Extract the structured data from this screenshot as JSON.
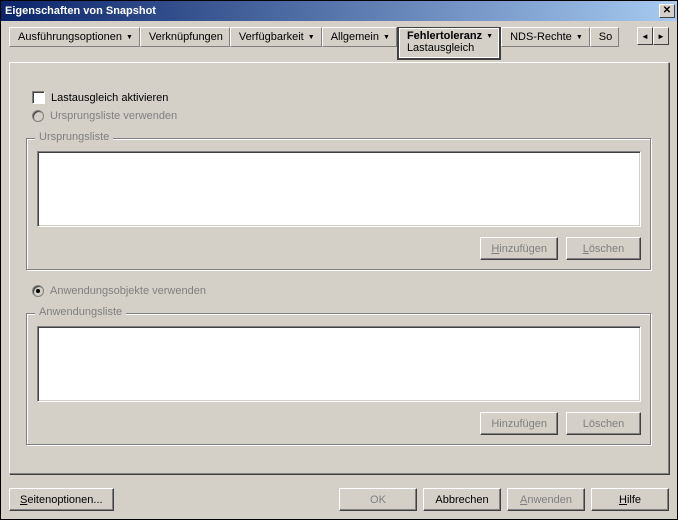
{
  "window_title": "Eigenschaften von Snapshot",
  "tabs": {
    "t0": "Ausführungsoptionen",
    "t1": "Verknüpfungen",
    "t2": "Verfügbarkeit",
    "t3": "Allgemein",
    "t4": "Fehlertoleranz",
    "t4_sub": "Lastausgleich",
    "t5": "NDS-Rechte",
    "t6": "So"
  },
  "checkbox_enable_label": "Lastausgleich aktivieren",
  "radio_source_label": "Ursprungsliste verwenden",
  "radio_app_label": "Anwendungsobjekte verwenden",
  "group_source_title": "Ursprungsliste",
  "group_app_title": "Anwendungsliste",
  "btn_add": "Hinzufügen",
  "btn_delete": "Löschen",
  "footer": {
    "page_options": "Seitenoptionen...",
    "ok": "OK",
    "cancel": "Abbrechen",
    "apply": "Anwenden",
    "help": "Hilfe"
  }
}
